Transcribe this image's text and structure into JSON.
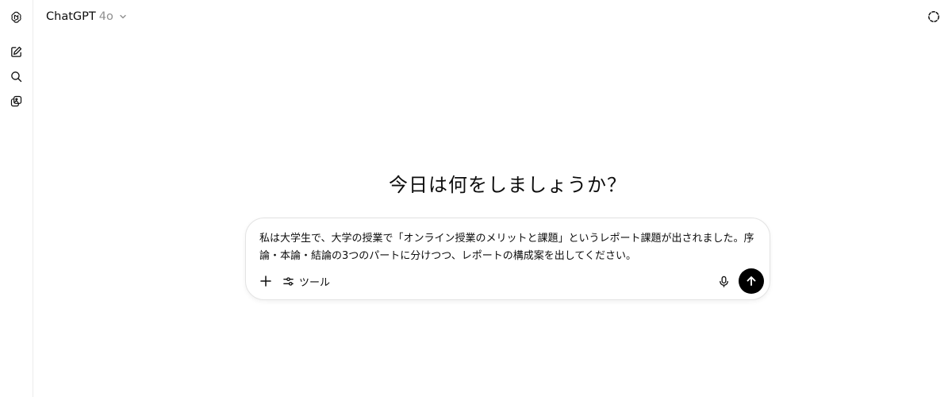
{
  "sidebar": {
    "items": [
      {
        "icon": "openai-logo-icon"
      },
      {
        "icon": "new-chat-icon"
      },
      {
        "icon": "search-icon"
      },
      {
        "icon": "library-icon"
      }
    ]
  },
  "header": {
    "title": "ChatGPT",
    "model": "4o",
    "temporary_chat_icon": "temporary-chat-icon"
  },
  "main": {
    "headline": "今日は何をしましょうか？"
  },
  "composer": {
    "prompt": "私は大学生で、大学の授業で「オンライン授業のメリットと課題」というレポート課題が出されました。序論・本論・結論の3つのパートに分けつつ、レポートの構成案を出してください。",
    "tools_label": "ツール",
    "send_color": "#000000"
  }
}
